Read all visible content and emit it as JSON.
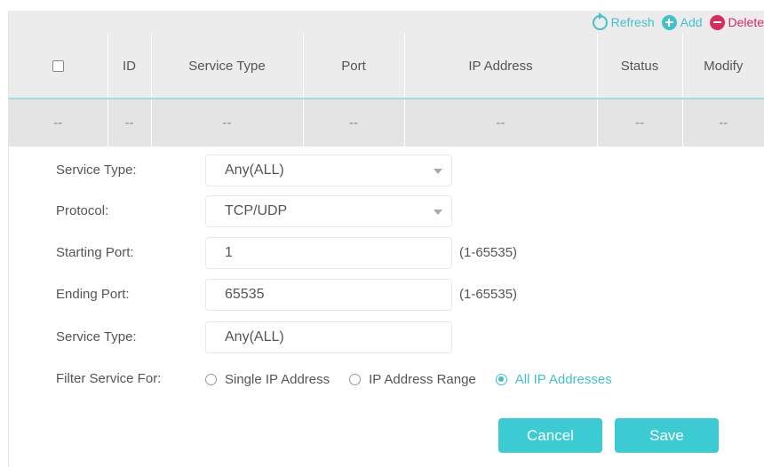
{
  "toolbar": {
    "refresh_label": "Refresh",
    "add_label": "Add",
    "delete_label": "Delete"
  },
  "table": {
    "columns": [
      "ID",
      "Service Type",
      "Port",
      "IP Address",
      "Status",
      "Modify"
    ],
    "rows": [
      [
        "--",
        "--",
        "--",
        "--",
        "--",
        "--",
        "--"
      ]
    ]
  },
  "form": {
    "service_type": {
      "label": "Service Type:",
      "value": "Any(ALL)"
    },
    "protocol": {
      "label": "Protocol:",
      "value": "TCP/UDP"
    },
    "starting_port": {
      "label": "Starting Port:",
      "value": "1",
      "range": "(1-65535)"
    },
    "ending_port": {
      "label": "Ending Port:",
      "value": "65535",
      "range": "(1-65535)"
    },
    "service_type_2": {
      "label": "Service Type:",
      "value": "Any(ALL)"
    },
    "filter": {
      "label": "Filter Service For:",
      "options": [
        "Single IP Address",
        "IP Address Range",
        "All IP Addresses"
      ],
      "selected": "All IP Addresses"
    }
  },
  "buttons": {
    "cancel": "Cancel",
    "save": "Save"
  },
  "colors": {
    "accent": "#42c1cc",
    "danger": "#d92c5e",
    "button": "#3ccbd3"
  }
}
